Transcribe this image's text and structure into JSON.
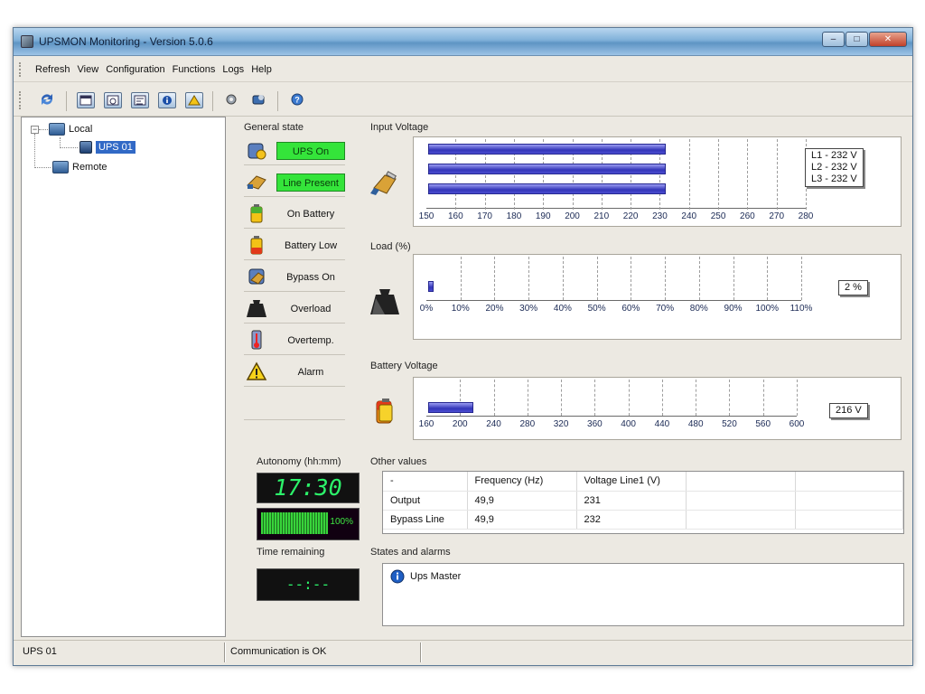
{
  "window": {
    "title": "UPSMON Monitoring - Version 5.0.6"
  },
  "menu": [
    "Refresh",
    "View",
    "Configuration",
    "Functions",
    "Logs",
    "Help"
  ],
  "toolbar_icons": [
    "refresh-icon",
    "view-window-icon",
    "search-window-icon",
    "network-icon",
    "info-icon",
    "warning-icon",
    "configure-icon",
    "ups-settings-icon",
    "help-icon"
  ],
  "tree": {
    "root_local": "Local",
    "ups_node": "UPS 01",
    "root_remote": "Remote"
  },
  "general_state": {
    "title": "General state",
    "items": [
      {
        "label": "UPS On",
        "active": true,
        "icon": "ups-on-icon"
      },
      {
        "label": "Line Present",
        "active": true,
        "icon": "line-present-icon"
      },
      {
        "label": "On Battery",
        "active": false,
        "icon": "battery-icon"
      },
      {
        "label": "Battery Low",
        "active": false,
        "icon": "battery-low-icon"
      },
      {
        "label": "Bypass On",
        "active": false,
        "icon": "bypass-icon"
      },
      {
        "label": "Overload",
        "active": false,
        "icon": "weight-icon"
      },
      {
        "label": "Overtemp.",
        "active": false,
        "icon": "thermometer-icon"
      },
      {
        "label": "Alarm",
        "active": false,
        "icon": "alarm-warning-icon"
      }
    ]
  },
  "input_voltage": {
    "title": "Input Voltage",
    "ticks": [
      "150",
      "160",
      "170",
      "180",
      "190",
      "200",
      "210",
      "220",
      "230",
      "240",
      "250",
      "260",
      "270",
      "280"
    ],
    "range": [
      150,
      280
    ],
    "values": [
      232,
      232,
      232
    ],
    "readout": [
      "L1 - 232 V",
      "L2 - 232 V",
      "L3 - 232 V"
    ]
  },
  "load": {
    "title": "Load (%)",
    "ticks": [
      "0%",
      "10%",
      "20%",
      "30%",
      "40%",
      "50%",
      "60%",
      "70%",
      "80%",
      "90%",
      "100%",
      "110%"
    ],
    "range": [
      0,
      110
    ],
    "value": 2,
    "readout": "2 %"
  },
  "battery_voltage": {
    "title": "Battery Voltage",
    "ticks": [
      "160",
      "200",
      "240",
      "280",
      "320",
      "360",
      "400",
      "440",
      "480",
      "520",
      "560",
      "600"
    ],
    "range": [
      160,
      600
    ],
    "value": 216,
    "readout": "216 V"
  },
  "autonomy": {
    "title": "Autonomy (hh:mm)",
    "value": "17:30",
    "charge_percent": 100,
    "charge_label": "100%"
  },
  "time_remaining": {
    "title": "Time remaining",
    "value": "--:--"
  },
  "other_values": {
    "title": "Other values",
    "headers": [
      "-",
      "Frequency (Hz)",
      "Voltage Line1 (V)",
      "",
      ""
    ],
    "rows": [
      [
        "Output",
        "49,9",
        "231",
        "",
        ""
      ],
      [
        "Bypass Line",
        "49,9",
        "232",
        "",
        ""
      ]
    ]
  },
  "states_alarms": {
    "title": "States and alarms",
    "entries": [
      "Ups Master"
    ]
  },
  "statusbar": {
    "left": "UPS 01",
    "middle": "Communication is OK"
  },
  "colors": {
    "active_green": "#34e43a",
    "bar_blue": "#3335b8",
    "digital_green": "#2cf26a"
  }
}
